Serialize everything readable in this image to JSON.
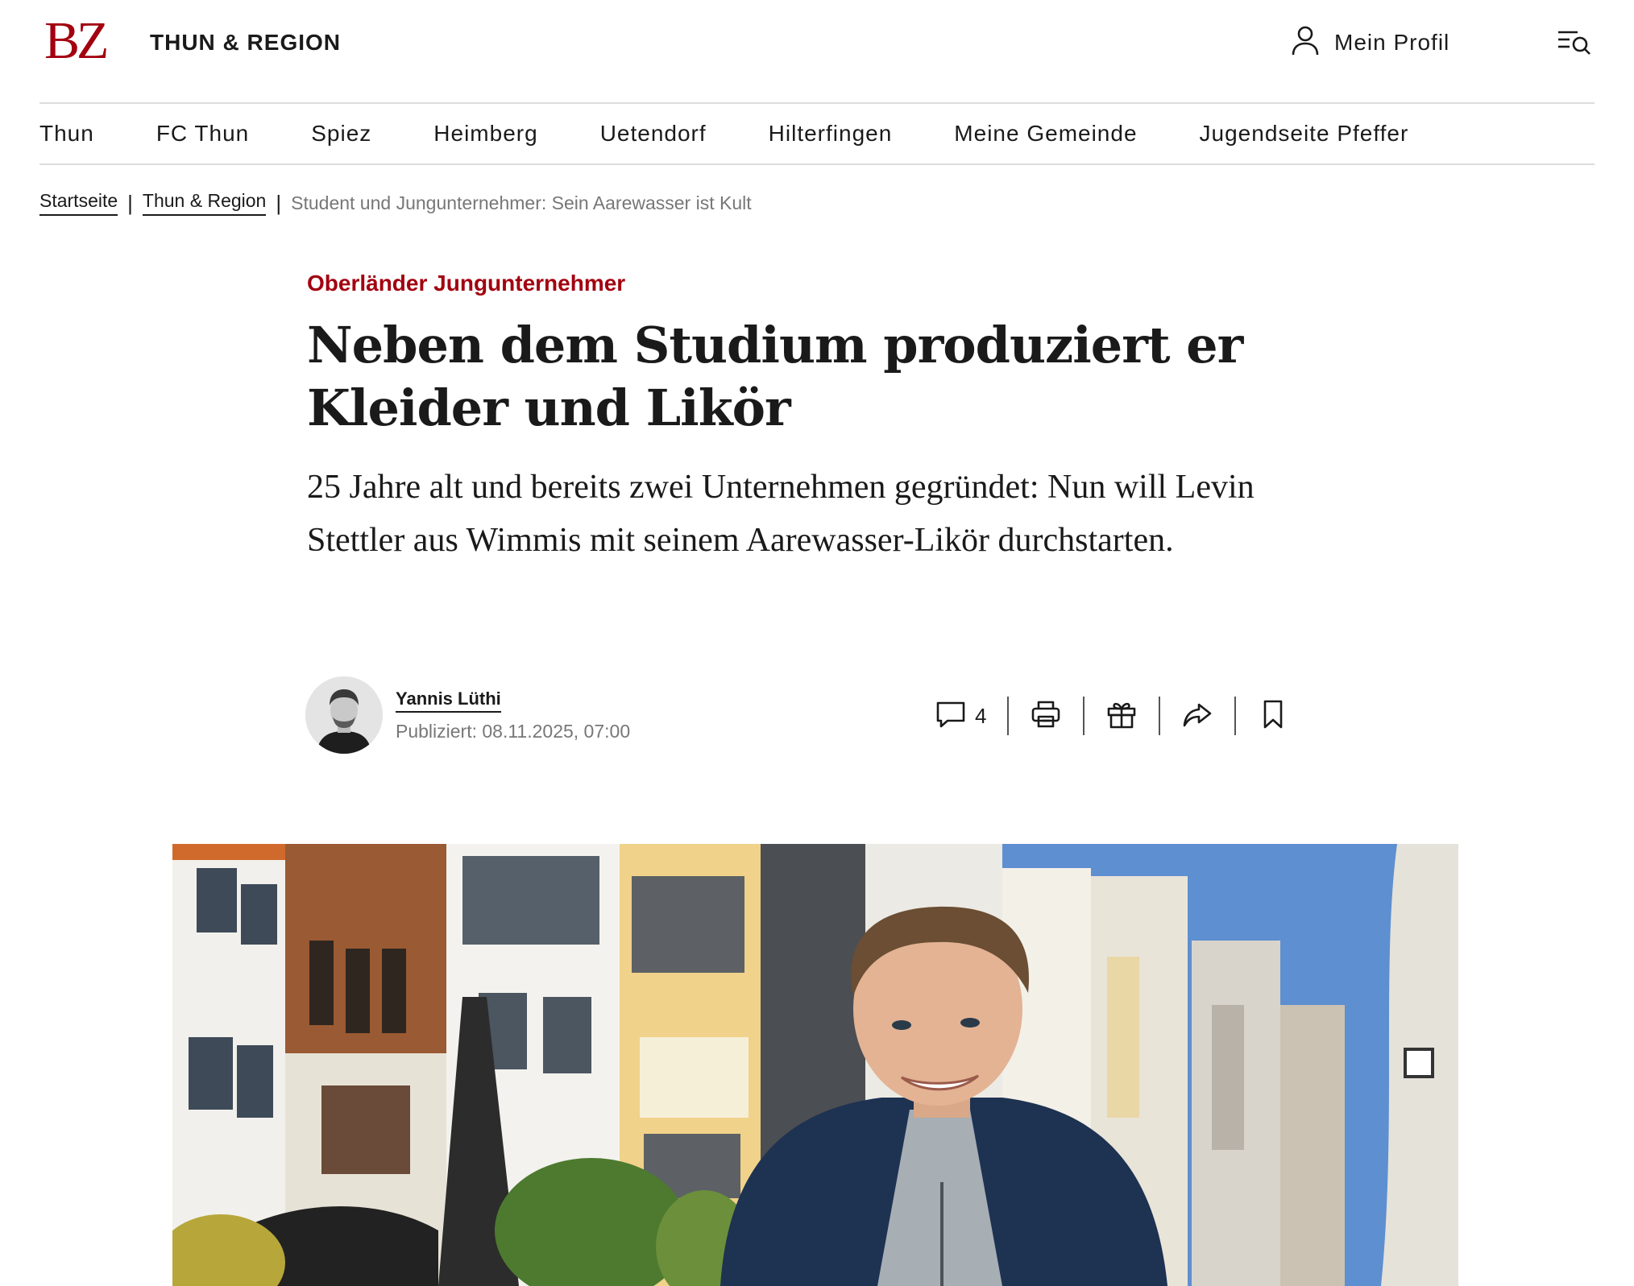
{
  "header": {
    "logo": "BZ",
    "section_title": "THUN & REGION",
    "profile_label": "Mein Profil",
    "icons": {
      "profile": "user-icon",
      "menu_search": "menu-search-icon"
    }
  },
  "nav": {
    "items": [
      {
        "label": "Thun"
      },
      {
        "label": "FC Thun"
      },
      {
        "label": "Spiez"
      },
      {
        "label": "Heimberg"
      },
      {
        "label": "Uetendorf"
      },
      {
        "label": "Hilterfingen"
      },
      {
        "label": "Meine Gemeinde"
      },
      {
        "label": "Jugendseite Pfeffer"
      }
    ]
  },
  "breadcrumb": {
    "items": [
      "Startseite",
      "Thun & Region"
    ],
    "separator": "|",
    "current": "Student und Jungunternehmer: Sein Aarewasser ist Kult"
  },
  "article": {
    "kicker": "Oberländer Jungunternehmer",
    "headline": "Neben dem Studium produziert er Kleider und Likör",
    "lead": "25 Jahre alt und bereits zwei Unternehmen gegründet: Nun will Levin Stettler aus Wimmis mit seinem Aarewasser-Likör durchstarten.",
    "author": "Yannis Lüthi",
    "published": "Publiziert: 08.11.2025, 07:00",
    "comment_count": "4",
    "action_icons": [
      "comment-icon",
      "print-icon",
      "gift-icon",
      "share-icon",
      "bookmark-icon"
    ]
  },
  "colors": {
    "brand_red": "#a2000f",
    "text": "#1a1a1a",
    "muted": "#777777",
    "divider": "#dcdcdc"
  }
}
